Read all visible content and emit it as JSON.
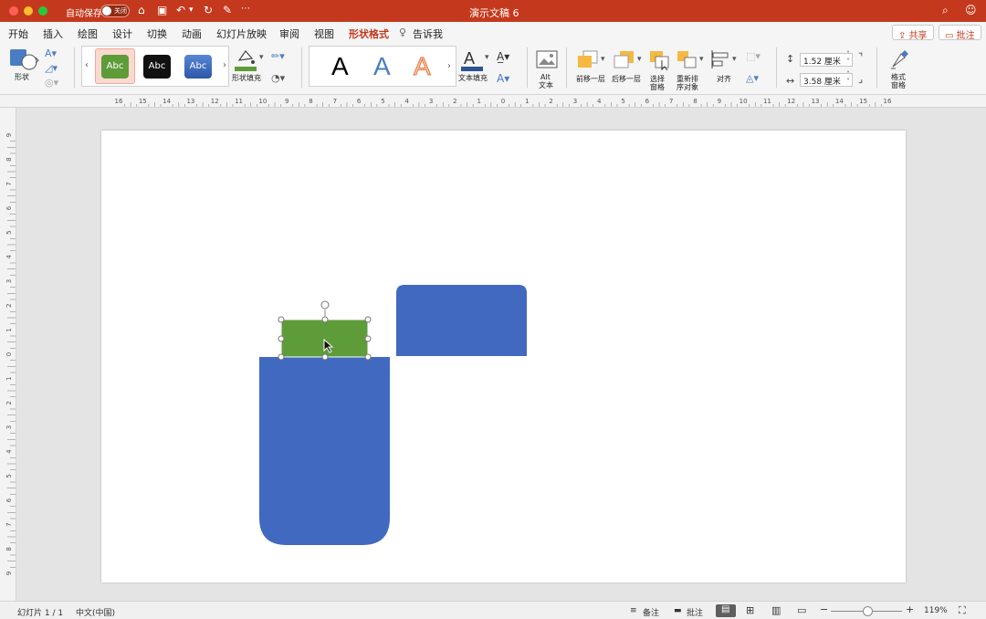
{
  "window": {
    "title": "演示文稿 6",
    "autosave_label": "自动保存",
    "autosave_state": "关闭"
  },
  "tabs": [
    {
      "label": "开始"
    },
    {
      "label": "插入"
    },
    {
      "label": "绘图"
    },
    {
      "label": "设计"
    },
    {
      "label": "切换"
    },
    {
      "label": "动画"
    },
    {
      "label": "幻灯片放映"
    },
    {
      "label": "审阅"
    },
    {
      "label": "视图"
    },
    {
      "label": "形状格式",
      "active": true
    },
    {
      "label": "告诉我"
    }
  ],
  "header_buttons": {
    "share": "共享",
    "comment": "批注"
  },
  "ribbon": {
    "shape_label": "形状",
    "shape_styles": [
      "Abc",
      "Abc",
      "Abc"
    ],
    "shape_fill_label": "形状填充",
    "wordart": [
      "A",
      "A",
      "A"
    ],
    "text_fill_label": "文本填充",
    "alt_text_label": "Alt 文本",
    "alt_line1": "Alt",
    "alt_line2": "文本",
    "bring_forward_label": "前移一层",
    "send_backward_label": "后移一层",
    "selection_pane_line1": "选择",
    "selection_pane_line2": "窗格",
    "reorder_line1": "重新排",
    "reorder_line2": "序对象",
    "align_label": "对齐",
    "height_value": "1.52 厘米",
    "width_value": "3.58 厘米",
    "format_pane_line1": "格式",
    "format_pane_line2": "窗格"
  },
  "ruler": {
    "h_ticks": [
      "16",
      "15",
      "14",
      "13",
      "12",
      "11",
      "10",
      "9",
      "8",
      "7",
      "6",
      "5",
      "4",
      "3",
      "2",
      "1",
      "0",
      "1",
      "2",
      "3",
      "4",
      "5",
      "6",
      "7",
      "8",
      "9",
      "10",
      "11",
      "12",
      "13",
      "14",
      "15",
      "16"
    ],
    "v_ticks": [
      "9",
      "8",
      "7",
      "6",
      "5",
      "4",
      "3",
      "2",
      "1",
      "0",
      "1",
      "2",
      "3",
      "4",
      "5",
      "6",
      "7",
      "8",
      "9"
    ]
  },
  "status": {
    "slide_info": "幻灯片 1 / 1",
    "language": "中文(中国)",
    "notes_label": "备注",
    "comments_label": "批注",
    "zoom": "119%"
  },
  "colors": {
    "accent": "#c4391d",
    "shape_blue": "#4169bf",
    "shape_green": "#5e9c3a"
  }
}
